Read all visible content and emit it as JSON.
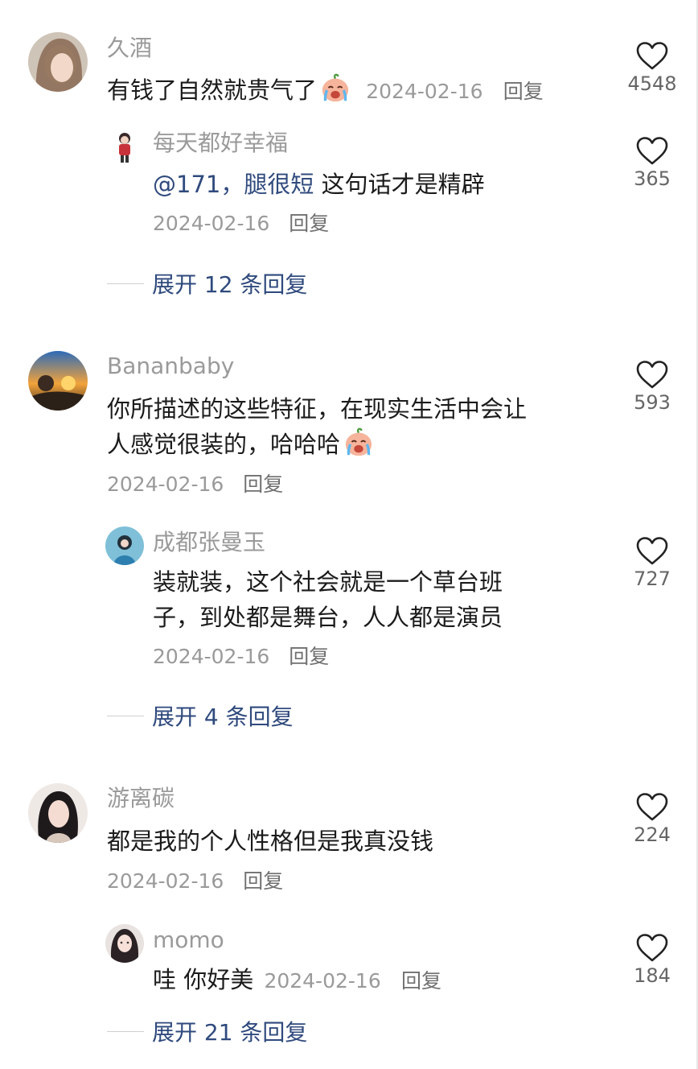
{
  "reply_label": "回复",
  "threads": [
    {
      "user": "久酒",
      "text": "有钱了自然就贵气了",
      "date": "2024-02-16",
      "likes": "4548",
      "replies": [
        {
          "user": "每天都好幸福",
          "mention": "@171，腿很短",
          "text": "这句话才是精辟",
          "date": "2024-02-16",
          "likes": "365"
        }
      ],
      "expand_label": "展开 12 条回复"
    },
    {
      "user": "Bananbaby",
      "text_lines": [
        "你所描述的这些特征，在现实生活中会让",
        "人感觉很装的，哈哈哈"
      ],
      "date": "2024-02-16",
      "likes": "593",
      "replies": [
        {
          "user": "成都张曼玉",
          "text_lines": [
            "装就装，这个社会就是一个草台班",
            "子，到处都是舞台，人人都是演员"
          ],
          "date": "2024-02-16",
          "likes": "727"
        }
      ],
      "expand_label": "展开 4 条回复"
    },
    {
      "user": "游离碳",
      "text": "都是我的个人性格但是我真没钱",
      "date": "2024-02-16",
      "likes": "224",
      "replies": [
        {
          "user": "momo",
          "text": "哇 你好美",
          "date": "2024-02-16",
          "likes": "184"
        }
      ],
      "expand_label": "展开 21 条回复"
    }
  ]
}
